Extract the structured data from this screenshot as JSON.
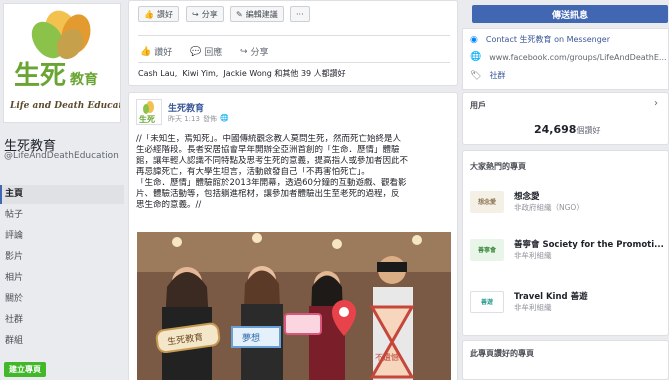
{
  "page": {
    "name": "生死教育",
    "handle": "@LifeAndDeathEducation",
    "logo_text_big": "生死教育",
    "logo_text_en": "Life and Death Education"
  },
  "nav": [
    {
      "label": "主頁",
      "active": true
    },
    {
      "label": "帖子"
    },
    {
      "label": "評論"
    },
    {
      "label": "影片"
    },
    {
      "label": "相片"
    },
    {
      "label": "關於"
    },
    {
      "label": "社群"
    },
    {
      "label": "群組"
    }
  ],
  "create_page_label": "建立專頁",
  "top_toolbar": {
    "like": "讚好",
    "share": "分享",
    "suggest": "編輯建議",
    "more": "···"
  },
  "top_post_actions": {
    "like": "讚好",
    "comment": "回應",
    "share": "分享"
  },
  "likers": {
    "names": [
      "Cash Lau",
      "Kiwi Yim",
      "Jackie Wong"
    ],
    "suffix": "和其他 39 人都讚好"
  },
  "post": {
    "author": "生死教育",
    "time": "昨天 1:13",
    "time_suffix": "發佈",
    "privacy_icon": "globe-icon",
    "lines": [
      "//「未知生，焉知死」。中國傳統觀念教人莫問生死，然而死亡始終是人",
      "生必經階段。長者安居協會早年開辦全亞洲首創的「生命．歷情」體驗",
      "館，讓年輕人認識不同特點及思考生死的意義，提高指人或參加者因此不",
      "再忌諱死亡，有大學生坦言，活動啟發自己「不再害怕死亡」。",
      "「生命．歷情」體驗館於2013年開幕，透過60分鐘的互動遊戲、觀看影",
      "片、體驗活動等，包括躺進棺材，讓參加者體驗出生至老死的過程，反",
      "思生命的意義。//"
    ],
    "photo_signs": [
      "生死教育",
      "夢想",
      "不遺憾"
    ]
  },
  "right": {
    "send_message": "傳送訊息",
    "info": [
      {
        "icon": "messenger-icon",
        "text": "Contact 生死教育 on Messenger",
        "link": true
      },
      {
        "icon": "globe-icon",
        "text": "www.facebook.com/groups/LifeAndDeathE...",
        "link": false
      },
      {
        "icon": "tag-icon",
        "text": "社群",
        "link": true
      }
    ],
    "users": {
      "title": "用戶",
      "count": "24,698",
      "count_suffix": "個讚好"
    },
    "liked_pages": {
      "title": "大家熱門的專頁",
      "items": [
        {
          "name": "想念愛",
          "category": "非政府組織（NGO）",
          "thumb_text": "想念愛",
          "color": "#f4f0e6",
          "text_color": "#8a7350"
        },
        {
          "name": "善寧會 Society for the Promoti...",
          "category": "非牟利組織",
          "thumb_text": "善寧會",
          "color": "#e9f5e9",
          "text_color": "#3b8a3e"
        },
        {
          "name": "Travel Kind 善遊",
          "category": "非牟利組織",
          "thumb_text": "善遊",
          "color": "#ffffff",
          "text_color": "#2a9d8f"
        }
      ]
    },
    "other_pages_title": "此專頁讚好的專頁"
  }
}
